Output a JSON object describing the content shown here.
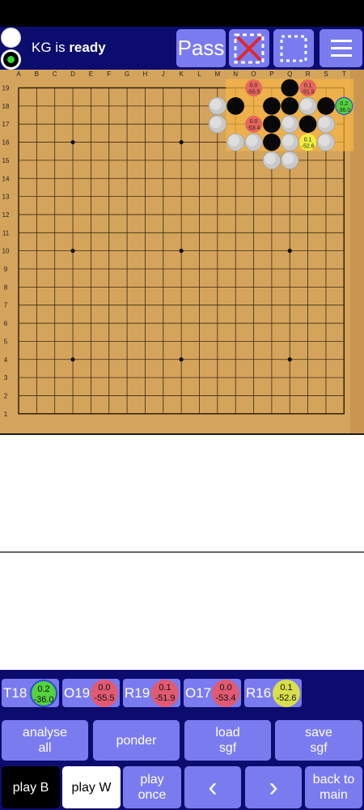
{
  "status": {
    "engine": "KG",
    "text": "is",
    "state": "ready"
  },
  "toolbar": {
    "pass": "Pass"
  },
  "board": {
    "size": 19,
    "columns": [
      "A",
      "B",
      "C",
      "D",
      "E",
      "F",
      "G",
      "H",
      "J",
      "K",
      "L",
      "M",
      "N",
      "O",
      "P",
      "Q",
      "R",
      "S",
      "T"
    ],
    "rows": [
      "19",
      "18",
      "17",
      "16",
      "15",
      "14",
      "13",
      "12",
      "11",
      "10",
      "9",
      "8",
      "7",
      "6",
      "5",
      "4",
      "3",
      "2",
      "1"
    ],
    "hoshi": [
      "D16",
      "K16",
      "D10",
      "K10",
      "Q10",
      "D4",
      "K4",
      "Q4"
    ],
    "stones": [
      {
        "pt": "Q19",
        "c": "B"
      },
      {
        "pt": "M18",
        "c": "W"
      },
      {
        "pt": "N18",
        "c": "B"
      },
      {
        "pt": "P18",
        "c": "B"
      },
      {
        "pt": "Q18",
        "c": "B"
      },
      {
        "pt": "R18",
        "c": "W"
      },
      {
        "pt": "S18",
        "c": "B"
      },
      {
        "pt": "M17",
        "c": "W"
      },
      {
        "pt": "P17",
        "c": "B"
      },
      {
        "pt": "Q17",
        "c": "W"
      },
      {
        "pt": "R17",
        "c": "B"
      },
      {
        "pt": "S17",
        "c": "W"
      },
      {
        "pt": "N16",
        "c": "W"
      },
      {
        "pt": "O16",
        "c": "W"
      },
      {
        "pt": "P16",
        "c": "B"
      },
      {
        "pt": "Q16",
        "c": "W"
      },
      {
        "pt": "S16",
        "c": "W"
      },
      {
        "pt": "P15",
        "c": "W"
      },
      {
        "pt": "Q15",
        "c": "W"
      }
    ],
    "candidates": [
      {
        "pt": "O19",
        "v1": "0.0",
        "v2": "-55.5",
        "color": "#e8665d"
      },
      {
        "pt": "R19",
        "v1": "0.1",
        "v2": "-51.9",
        "color": "#e8665d"
      },
      {
        "pt": "T18",
        "v1": "0.2",
        "v2": "-36.0",
        "color": "#55d23d",
        "ring": "#2c4dd8"
      },
      {
        "pt": "O17",
        "v1": "0.0",
        "v2": "-53.4",
        "color": "#e8665d"
      },
      {
        "pt": "R16",
        "v1": "0.1",
        "v2": "-52.6",
        "color": "#f0ef3c"
      }
    ]
  },
  "moves": [
    {
      "coord": "T18",
      "v1": "0.2",
      "v2": "-36.0",
      "color": "#55d23d",
      "ring": "#2c4dd8"
    },
    {
      "coord": "O19",
      "v1": "0.0",
      "v2": "-55.5",
      "color": "#e25a72"
    },
    {
      "coord": "R19",
      "v1": "0.1",
      "v2": "-51.9",
      "color": "#e25a72"
    },
    {
      "coord": "O17",
      "v1": "0.0",
      "v2": "-53.4",
      "color": "#e25a72"
    },
    {
      "coord": "R16",
      "v1": "0.1",
      "v2": "-52.6",
      "color": "#d8df4a"
    }
  ],
  "buttons": {
    "analyse_all_1": "analyse",
    "analyse_all_2": "all",
    "ponder": "ponder",
    "load_1": "load",
    "load_2": "sgf",
    "save_1": "save",
    "save_2": "sgf",
    "play_b": "play B",
    "play_w": "play W",
    "play_once_1": "play",
    "play_once_2": "once",
    "prev": "‹",
    "next": "›",
    "back_1": "back to",
    "back_2": "main"
  }
}
